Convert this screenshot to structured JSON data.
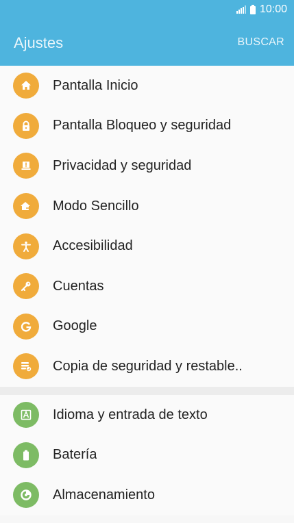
{
  "status": {
    "time": "10:00"
  },
  "appbar": {
    "title": "Ajustes",
    "search_label": "BUSCAR"
  },
  "section1": [
    {
      "label": "Pantalla Inicio",
      "icon": "home-icon"
    },
    {
      "label": "Pantalla Bloqueo y seguridad",
      "icon": "lock-icon"
    },
    {
      "label": "Privacidad y seguridad",
      "icon": "privacy-icon"
    },
    {
      "label": "Modo Sencillo",
      "icon": "easy-mode-icon"
    },
    {
      "label": "Accesibilidad",
      "icon": "accessibility-icon"
    },
    {
      "label": "Cuentas",
      "icon": "key-icon"
    },
    {
      "label": "Google",
      "icon": "google-icon"
    },
    {
      "label": "Copia de seguridad y restable..",
      "icon": "backup-icon"
    }
  ],
  "section2": [
    {
      "label": "Idioma y entrada de texto",
      "icon": "language-icon"
    },
    {
      "label": "Batería",
      "icon": "battery-icon"
    },
    {
      "label": "Almacenamiento",
      "icon": "storage-icon"
    }
  ],
  "colors": {
    "header": "#4eb4de",
    "orange_icon": "#f0ab3b",
    "green_icon": "#7dbb64"
  }
}
